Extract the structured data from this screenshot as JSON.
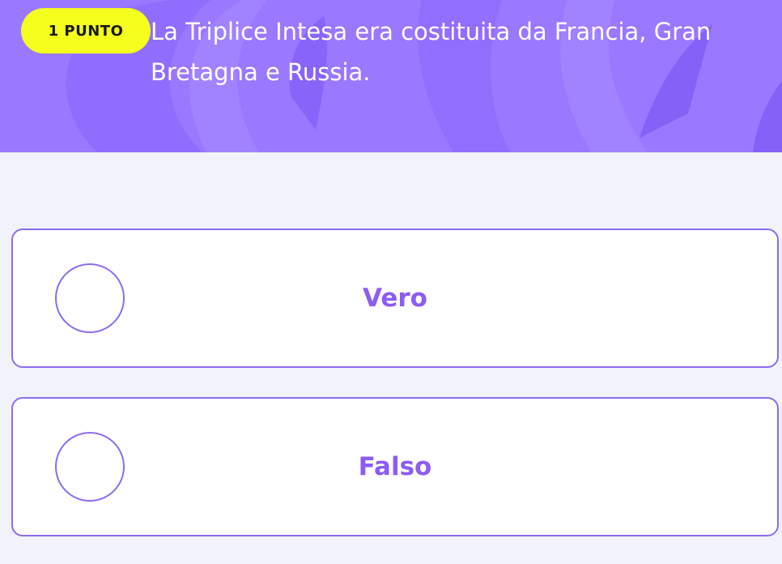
{
  "header": {
    "points_badge": "1 PUNTO",
    "question": "La Triplice Intesa era costituita da Francia, Gran Bretagna e Russia."
  },
  "options": [
    {
      "label": "Vero"
    },
    {
      "label": "Falso"
    }
  ],
  "colors": {
    "header_bg": "#9a78ff",
    "badge_bg": "#f4ff1e",
    "accent": "#8c6cf0",
    "page_bg": "#f2f2fa"
  }
}
